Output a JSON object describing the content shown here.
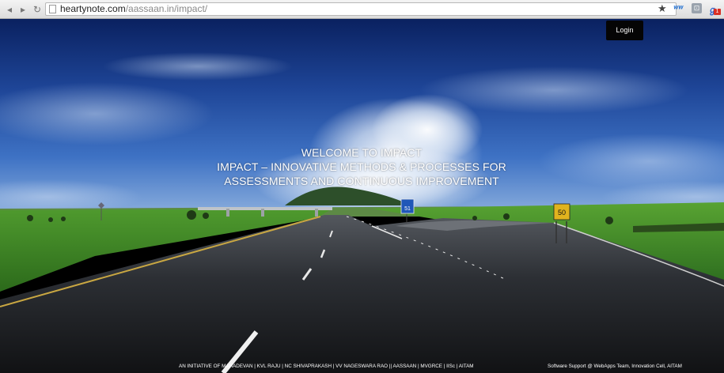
{
  "browser": {
    "back_icon": "back-arrow-icon",
    "forward_icon": "forward-arrow-icon",
    "reload_icon": "reload-icon",
    "url_host": "heartynote.com",
    "url_path": "/aassaan.in/impact/",
    "bookmark_icon": "star-icon",
    "ext_badge_count": "1"
  },
  "header": {
    "login_label": "Login"
  },
  "hero": {
    "line1": "WELCOME TO IMPACT",
    "line2": "IMPACT – INNOVATIVE METHODS & PROCESSES FOR",
    "line3": "ASSESSMENTS AND CONTINUOUS IMPROVEMENT"
  },
  "scene": {
    "speed_sign": "50",
    "highway_sign": "51"
  },
  "footer": {
    "credits": "AN INITIATIVE OF MAHADEVAN | KVL RAJU | NC SHIVAPRAKASH | VV NAGESWARA RAO || AASSAAN | MVGRCE | IISc | AITAM",
    "support": "Software Support @ WebApps Team, Innovation Cell, AITAM"
  },
  "colors": {
    "sky_top": "#0d2a6e",
    "sky_mid": "#2f5db3",
    "grass": "#3f8f2a",
    "road": "#2b2e33",
    "button_bg": "#050505"
  }
}
